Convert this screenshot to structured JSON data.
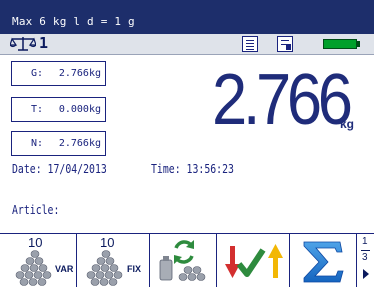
{
  "header": {
    "max_text": "Max 6 kg l d = 1 g"
  },
  "status": {
    "scale_number": "1",
    "scale_icon": "scale-icon",
    "list_icon": "list-icon",
    "doc_icon": "document-icon",
    "battery_color": "#00a02a"
  },
  "weights": {
    "gross": {
      "label": "G:",
      "value": "2.766kg"
    },
    "tare": {
      "label": "T:",
      "value": "0.000kg"
    },
    "net": {
      "label": "N:",
      "value": "2.766kg"
    }
  },
  "display": {
    "value": "2.766",
    "unit": "kg"
  },
  "info": {
    "date": "Date: 17/04/2013",
    "time": "Time: 13:56:23",
    "article": "Article:"
  },
  "softkeys": {
    "var": {
      "number": "10",
      "tag": "VAR",
      "icon": "pile-var-icon"
    },
    "fix": {
      "number": "10",
      "tag": "FIX",
      "icon": "pile-fix-icon"
    },
    "refresh": {
      "icon": "refresh-weights-icon"
    },
    "transfer": {
      "icon": "down-check-up-icon"
    },
    "sum": {
      "icon": "sigma-icon"
    },
    "pager": {
      "current": "1",
      "total": "3"
    }
  }
}
